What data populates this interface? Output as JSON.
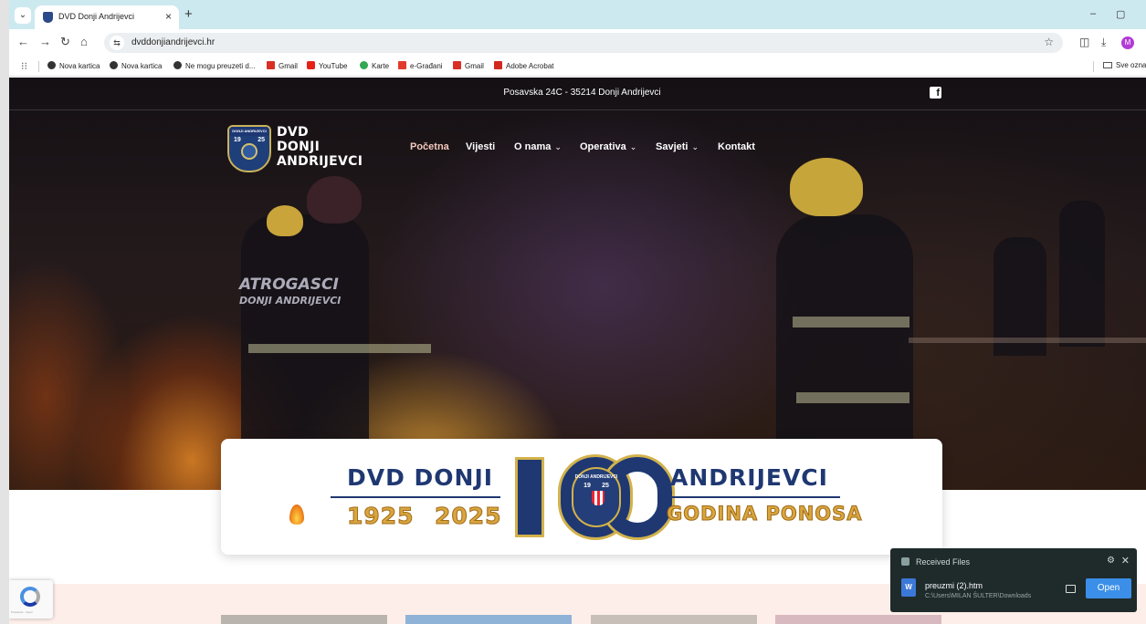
{
  "browser": {
    "tab_title": "DVD Donji Andrijevci",
    "tab_close": "×",
    "new_tab": "+",
    "tab_scroll": "⌄",
    "minimize": "–",
    "restore": "▢",
    "url": "dvddonjiandrijevci.hr",
    "back": "←",
    "forward": "→",
    "reload": "↻",
    "home": "⌂",
    "star": "☆",
    "extensions": "◫",
    "download": "⤓",
    "profile_initial": "M"
  },
  "bookmarks": {
    "apps": "⁝⁝",
    "items": [
      {
        "label": "Nova kartica",
        "color": "#333333"
      },
      {
        "label": "Nova kartica",
        "color": "#333333"
      },
      {
        "label": "Ne mogu preuzeti d...",
        "color": "#333333"
      },
      {
        "label": "Gmail",
        "color": "#d93025"
      },
      {
        "label": "YouTube",
        "color": "#e62117"
      },
      {
        "label": "Karte",
        "color": "#34a853"
      },
      {
        "label": "e-Građani",
        "color": "#e23b2e"
      },
      {
        "label": "Gmail",
        "color": "#d93025"
      },
      {
        "label": "Adobe Acrobat",
        "color": "#d2281e"
      }
    ],
    "right": "Sve ozna"
  },
  "site": {
    "address": "Posavska 24C - 35214 Donji Andrijevci",
    "facebook_glyph": "f",
    "logo_lines": [
      "DVD",
      "DONJI",
      "ANDRIJEVCI"
    ],
    "badge_top": "DONJI ANDRIJEVCI",
    "badge_year_left": "19",
    "badge_year_right": "25",
    "nav": [
      {
        "label": "Početna",
        "dropdown": false
      },
      {
        "label": "Vijesti",
        "dropdown": false
      },
      {
        "label": "O nama",
        "dropdown": true
      },
      {
        "label": "Operativa",
        "dropdown": true
      },
      {
        "label": "Savjeti",
        "dropdown": true
      },
      {
        "label": "Kontakt",
        "dropdown": false
      }
    ],
    "chevron": "⌄",
    "hero_text": [
      "ATROGASCI",
      "DONJI ANDRIJEVCI"
    ]
  },
  "banner": {
    "left_top": "DVD DONJI",
    "left_bottom_year1": "1925",
    "left_bottom_year2": "2025",
    "right_top": "ANDRIJEVCI",
    "right_bottom": "GODINA PONOSA",
    "seal_top": "DONJI ANDRIJEVCI",
    "seal_year_left": "19",
    "seal_year_right": "25"
  },
  "recaptcha": {
    "text": "Privatnost - Uvjeti"
  },
  "toast": {
    "title": "Received Files",
    "close": "✕",
    "gear": "⚙",
    "file_name": "preuzmi (2).htm",
    "file_path": "C:\\Users\\MILAN ŠULTER\\Downloads",
    "open_label": "Open",
    "file_glyph": "W"
  },
  "colors": {
    "brand_blue": "#1f3872",
    "brand_gold": "#d3b24a",
    "toast_bg": "#1f2b2b",
    "open_button": "#3b8fe8",
    "nav_active": "#f4c9bd"
  }
}
